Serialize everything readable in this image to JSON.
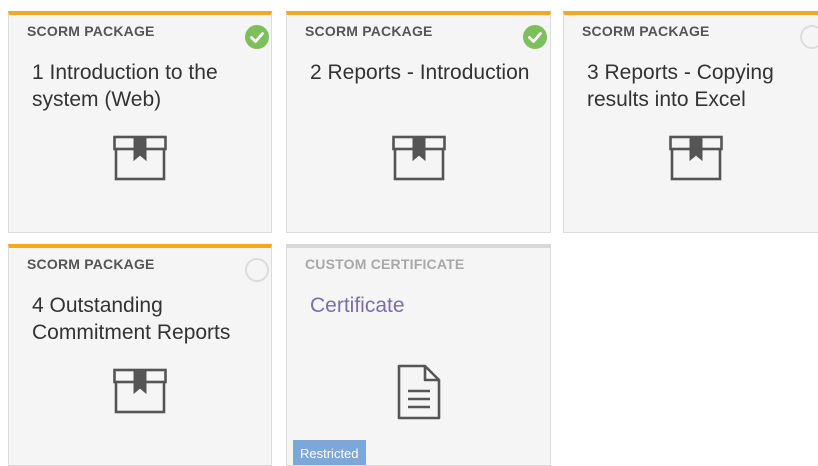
{
  "cards": [
    {
      "type": "SCORM PACKAGE",
      "title": "1 Introduction to the system (Web)",
      "status": "complete",
      "icon": "package-icon"
    },
    {
      "type": "SCORM PACKAGE",
      "title": "2 Reports - Introduction",
      "status": "complete",
      "icon": "package-icon"
    },
    {
      "type": "SCORM PACKAGE",
      "title": "3 Reports - Copying results into Excel",
      "status": "incomplete",
      "icon": "package-icon"
    },
    {
      "type": "SCORM PACKAGE",
      "title": "4 Outstanding Commitment Reports",
      "status": "incomplete",
      "icon": "package-icon"
    },
    {
      "type": "CUSTOM CERTIFICATE",
      "title": "Certificate",
      "status": "none",
      "icon": "document-icon",
      "badge": "Restricted"
    }
  ],
  "colors": {
    "accent": "#f6a623",
    "complete": "#7cbf5c",
    "certificate_title": "#7b6fa8",
    "restricted_badge": "#7da7d9"
  }
}
